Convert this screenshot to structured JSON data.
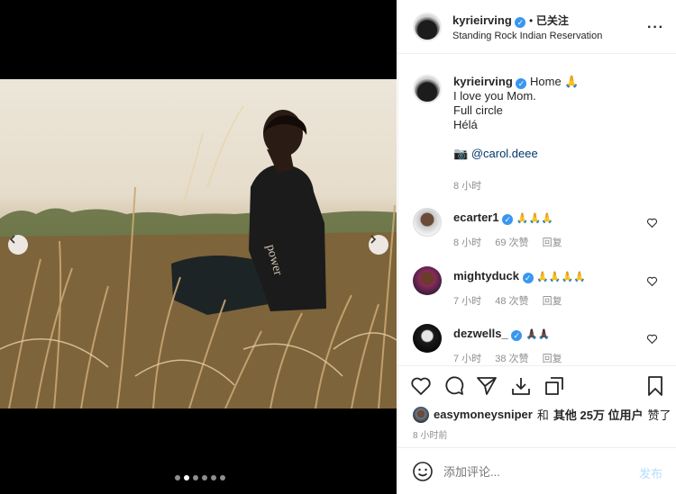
{
  "post": {
    "username": "kyrieirving",
    "follow_status": "已关注",
    "separator": "•",
    "location": "Standing Rock Indian Reservation",
    "caption_lines": [
      "Home 🙏",
      "I love you Mom.",
      "Full circle",
      "Hélá"
    ],
    "mention_prefix": "📷",
    "mention": "@carol.deee",
    "caption_time": "8 小时",
    "slide_count": 6,
    "active_slide": 1
  },
  "comments": [
    {
      "user": "ecarter1",
      "text": "🙏🙏🙏",
      "time": "8 小时",
      "likes": "69 次赞",
      "reply": "回复"
    },
    {
      "user": "mightyduck",
      "text": "🙏🙏🙏🙏",
      "time": "7 小时",
      "likes": "48 次赞",
      "reply": "回复"
    },
    {
      "user": "dezwells_",
      "text": "🙏🏿🙏🏿",
      "time": "7 小时",
      "likes": "38 次赞",
      "reply": "回复"
    }
  ],
  "likes_line": {
    "user": "easymoneysniper",
    "middle": "和",
    "others": "其他 25万 位用户",
    "suffix": "赞了"
  },
  "post_time": "8 小时前",
  "add_comment": {
    "placeholder": "添加评论...",
    "post_label": "发布"
  },
  "icons": {
    "more": "more-icon",
    "like": "heart-icon",
    "comment": "comment-icon",
    "share": "share-icon",
    "save": "bookmark-icon",
    "emoji": "emoji-icon"
  },
  "colors": {
    "accent": "#3897f0",
    "post_button": "#b2dffc",
    "muted": "#8e8e8e"
  }
}
